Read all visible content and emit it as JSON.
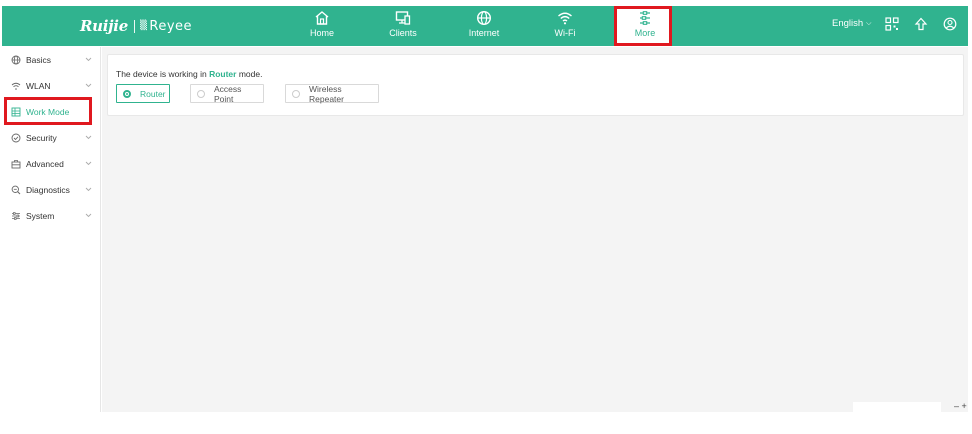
{
  "brand": {
    "logo_main": "Ruijie",
    "logo_sub": "Reyee",
    "logo_mark": "▒"
  },
  "nav": {
    "items": [
      {
        "label": "Home",
        "icon": "home-icon"
      },
      {
        "label": "Clients",
        "icon": "clients-icon"
      },
      {
        "label": "Internet",
        "icon": "globe-icon"
      },
      {
        "label": "Wi-Fi",
        "icon": "wifi-icon"
      },
      {
        "label": "More",
        "icon": "settings-sliders-icon"
      }
    ],
    "active": "More"
  },
  "header": {
    "language": "English",
    "icons": [
      "qr-code-icon",
      "upgrade-icon",
      "user-icon"
    ]
  },
  "sidebar": {
    "items": [
      {
        "label": "Basics",
        "icon": "globe-icon"
      },
      {
        "label": "WLAN",
        "icon": "wifi-icon"
      },
      {
        "label": "Work Mode",
        "icon": "work-mode-icon"
      },
      {
        "label": "Security",
        "icon": "shield-icon"
      },
      {
        "label": "Advanced",
        "icon": "advanced-icon"
      },
      {
        "label": "Diagnostics",
        "icon": "diagnostics-icon"
      },
      {
        "label": "System",
        "icon": "system-icon"
      }
    ],
    "active": "Work Mode"
  },
  "main": {
    "mode_text_prefix": "The device is working in ",
    "mode_text_current": "Router",
    "mode_text_suffix": " mode.",
    "options": [
      {
        "label": "Router",
        "selected": true
      },
      {
        "label": "Access Point",
        "selected": false
      },
      {
        "label": "Wireless Repeater",
        "selected": false
      }
    ]
  },
  "corner": {
    "mark": "– +"
  },
  "colors": {
    "accent": "#30b38f",
    "highlight": "#e0181f",
    "background": "#f4f4f4"
  }
}
